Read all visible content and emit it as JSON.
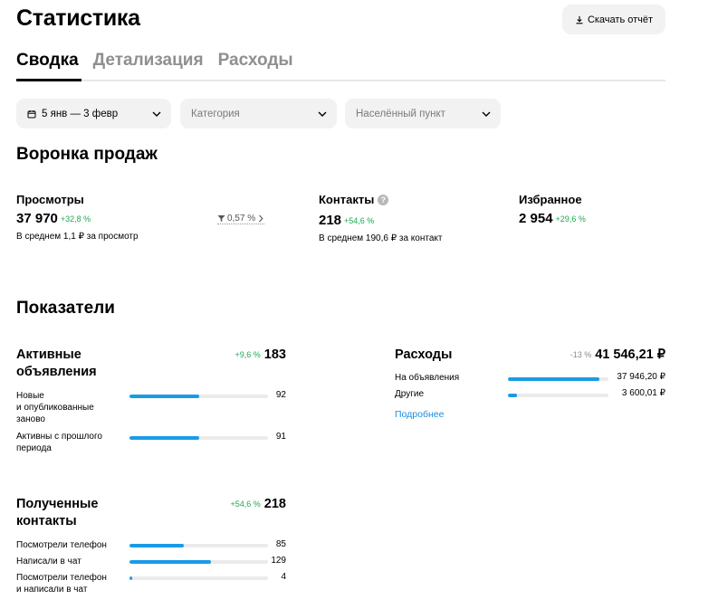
{
  "header": {
    "title": "Статистика",
    "download_label": "Скачать отчёт"
  },
  "tabs": [
    {
      "label": "Сводка",
      "active": true
    },
    {
      "label": "Детализация",
      "active": false
    },
    {
      "label": "Расходы",
      "active": false
    }
  ],
  "filters": {
    "date": "5 янв — 3 февр",
    "category_placeholder": "Категория",
    "city_placeholder": "Населённый пункт"
  },
  "funnel": {
    "title": "Воронка продаж",
    "views": {
      "label": "Просмотры",
      "value": "37 970",
      "delta": "+32,8 %",
      "sub": "В среднем 1,1 ₽ за просмотр"
    },
    "conversion": "0,57 %",
    "contacts": {
      "label": "Контакты",
      "help": "?",
      "value": "218",
      "delta": "+54,6 %",
      "sub": "В среднем 190,6 ₽ за контакт"
    },
    "favorites": {
      "label": "Избранное",
      "value": "2 954",
      "delta": "+29,6 %"
    }
  },
  "indicators": {
    "title": "Показатели",
    "active_ads": {
      "title": "Активные\nобъявления",
      "delta": "+9,6 %",
      "total": "183",
      "rows": [
        {
          "label": "Новые\nи опубликованные\nзаново",
          "value": "92",
          "fraction": 0.5
        },
        {
          "label": "Активны с прошлого\nпериода",
          "value": "91",
          "fraction": 0.5
        }
      ]
    },
    "expenses": {
      "title": "Расходы",
      "delta": "-13 %",
      "total": "41 546,21 ₽",
      "rows": [
        {
          "label": "На объявления",
          "value": "37 946,20 ₽",
          "fraction": 0.91
        },
        {
          "label": "Другие",
          "value": "3 600,01 ₽",
          "fraction": 0.09
        }
      ],
      "more_link": "Подробнее"
    },
    "contacts": {
      "title": "Полученные\nконтакты",
      "delta": "+54,6 %",
      "total": "218",
      "rows": [
        {
          "label": "Посмотрели телефон",
          "value": "85",
          "fraction": 0.39
        },
        {
          "label": "Написали в чат",
          "value": "129",
          "fraction": 0.59
        },
        {
          "label": "Посмотрели телефон\nи написали в чат",
          "value": "4",
          "fraction": 0.02
        }
      ]
    }
  },
  "colors": {
    "accent_bar": "#1a9be6",
    "positive": "#1fa94f",
    "link": "#1a8fe0"
  }
}
